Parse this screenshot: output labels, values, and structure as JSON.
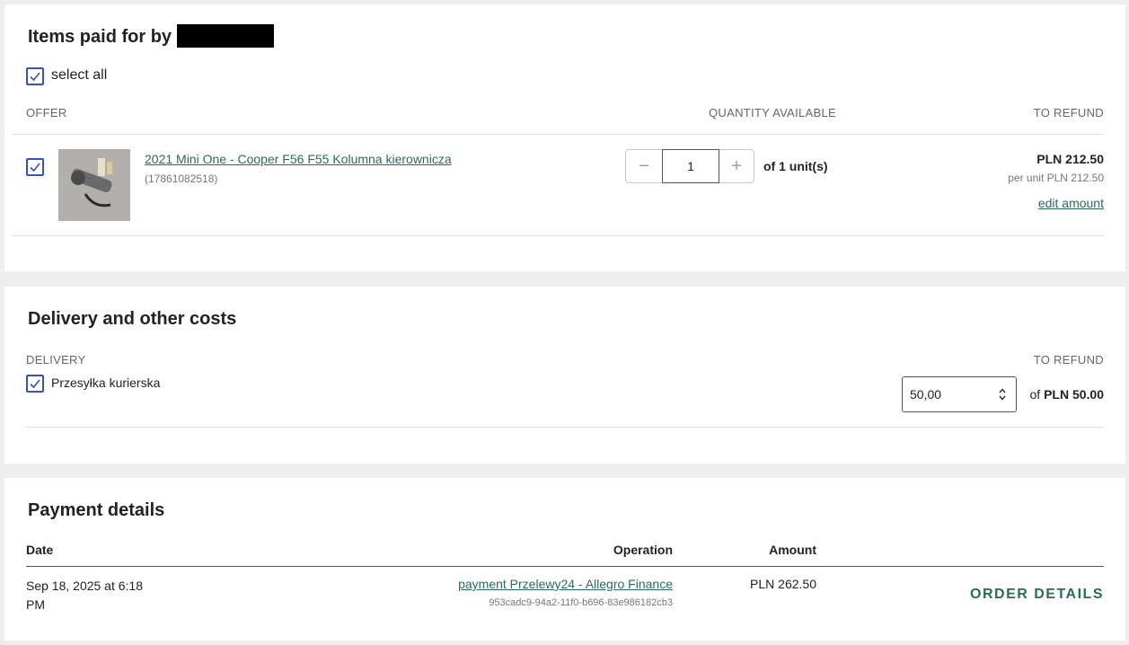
{
  "items": {
    "title": "Items paid for by",
    "select_all": "select all",
    "col_offer": "OFFER",
    "col_quantity": "QUANTITY AVAILABLE",
    "col_refund": "TO REFUND",
    "product": {
      "name": "2021 Mini One - Cooper F56 F55 Kolumna kierownicza",
      "id": "(17861082518)",
      "quantity": "1",
      "of_units": "of 1 unit(s)",
      "price": "PLN 212.50",
      "per_unit": "per unit PLN 212.50",
      "edit_amount": "edit amount"
    }
  },
  "delivery": {
    "title": "Delivery and other costs",
    "col_delivery": "DELIVERY",
    "col_refund": "TO REFUND",
    "method": "Przesyłka kurierska",
    "amount_value": "50,00",
    "of_label": "of",
    "of_amount": "PLN 50.00"
  },
  "payment": {
    "title": "Payment details",
    "col_date": "Date",
    "col_operation": "Operation",
    "col_amount": "Amount",
    "row": {
      "date_line1": "Sep 18, 2025 at 6:18",
      "date_line2": "PM",
      "operation": "payment Przelewy24 - Allegro Finance",
      "operation_id": "953cadc9-94a2-11f0-b696-83e986182cb3",
      "amount": "PLN 262.50"
    },
    "order_details": "ORDER DETAILS"
  },
  "colors": {
    "checkbox": "#3b53b8",
    "link": "#2b6b5c",
    "background": "#eeeeee"
  }
}
